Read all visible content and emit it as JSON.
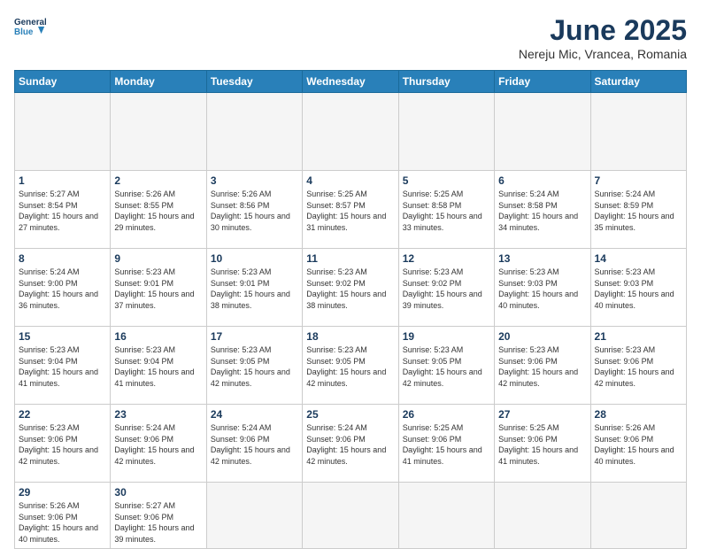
{
  "header": {
    "logo_general": "General",
    "logo_blue": "Blue",
    "title": "June 2025",
    "subtitle": "Nereju Mic, Vrancea, Romania"
  },
  "calendar": {
    "days_of_week": [
      "Sunday",
      "Monday",
      "Tuesday",
      "Wednesday",
      "Thursday",
      "Friday",
      "Saturday"
    ],
    "weeks": [
      [
        {
          "num": "",
          "empty": true
        },
        {
          "num": "",
          "empty": true
        },
        {
          "num": "",
          "empty": true
        },
        {
          "num": "",
          "empty": true
        },
        {
          "num": "",
          "empty": true
        },
        {
          "num": "",
          "empty": true
        },
        {
          "num": "",
          "empty": true
        }
      ],
      [
        {
          "num": "1",
          "sunrise": "Sunrise: 5:27 AM",
          "sunset": "Sunset: 8:54 PM",
          "daylight": "Daylight: 15 hours and 27 minutes."
        },
        {
          "num": "2",
          "sunrise": "Sunrise: 5:26 AM",
          "sunset": "Sunset: 8:55 PM",
          "daylight": "Daylight: 15 hours and 29 minutes."
        },
        {
          "num": "3",
          "sunrise": "Sunrise: 5:26 AM",
          "sunset": "Sunset: 8:56 PM",
          "daylight": "Daylight: 15 hours and 30 minutes."
        },
        {
          "num": "4",
          "sunrise": "Sunrise: 5:25 AM",
          "sunset": "Sunset: 8:57 PM",
          "daylight": "Daylight: 15 hours and 31 minutes."
        },
        {
          "num": "5",
          "sunrise": "Sunrise: 5:25 AM",
          "sunset": "Sunset: 8:58 PM",
          "daylight": "Daylight: 15 hours and 33 minutes."
        },
        {
          "num": "6",
          "sunrise": "Sunrise: 5:24 AM",
          "sunset": "Sunset: 8:58 PM",
          "daylight": "Daylight: 15 hours and 34 minutes."
        },
        {
          "num": "7",
          "sunrise": "Sunrise: 5:24 AM",
          "sunset": "Sunset: 8:59 PM",
          "daylight": "Daylight: 15 hours and 35 minutes."
        }
      ],
      [
        {
          "num": "8",
          "sunrise": "Sunrise: 5:24 AM",
          "sunset": "Sunset: 9:00 PM",
          "daylight": "Daylight: 15 hours and 36 minutes."
        },
        {
          "num": "9",
          "sunrise": "Sunrise: 5:23 AM",
          "sunset": "Sunset: 9:01 PM",
          "daylight": "Daylight: 15 hours and 37 minutes."
        },
        {
          "num": "10",
          "sunrise": "Sunrise: 5:23 AM",
          "sunset": "Sunset: 9:01 PM",
          "daylight": "Daylight: 15 hours and 38 minutes."
        },
        {
          "num": "11",
          "sunrise": "Sunrise: 5:23 AM",
          "sunset": "Sunset: 9:02 PM",
          "daylight": "Daylight: 15 hours and 38 minutes."
        },
        {
          "num": "12",
          "sunrise": "Sunrise: 5:23 AM",
          "sunset": "Sunset: 9:02 PM",
          "daylight": "Daylight: 15 hours and 39 minutes."
        },
        {
          "num": "13",
          "sunrise": "Sunrise: 5:23 AM",
          "sunset": "Sunset: 9:03 PM",
          "daylight": "Daylight: 15 hours and 40 minutes."
        },
        {
          "num": "14",
          "sunrise": "Sunrise: 5:23 AM",
          "sunset": "Sunset: 9:03 PM",
          "daylight": "Daylight: 15 hours and 40 minutes."
        }
      ],
      [
        {
          "num": "15",
          "sunrise": "Sunrise: 5:23 AM",
          "sunset": "Sunset: 9:04 PM",
          "daylight": "Daylight: 15 hours and 41 minutes."
        },
        {
          "num": "16",
          "sunrise": "Sunrise: 5:23 AM",
          "sunset": "Sunset: 9:04 PM",
          "daylight": "Daylight: 15 hours and 41 minutes."
        },
        {
          "num": "17",
          "sunrise": "Sunrise: 5:23 AM",
          "sunset": "Sunset: 9:05 PM",
          "daylight": "Daylight: 15 hours and 42 minutes."
        },
        {
          "num": "18",
          "sunrise": "Sunrise: 5:23 AM",
          "sunset": "Sunset: 9:05 PM",
          "daylight": "Daylight: 15 hours and 42 minutes."
        },
        {
          "num": "19",
          "sunrise": "Sunrise: 5:23 AM",
          "sunset": "Sunset: 9:05 PM",
          "daylight": "Daylight: 15 hours and 42 minutes."
        },
        {
          "num": "20",
          "sunrise": "Sunrise: 5:23 AM",
          "sunset": "Sunset: 9:06 PM",
          "daylight": "Daylight: 15 hours and 42 minutes."
        },
        {
          "num": "21",
          "sunrise": "Sunrise: 5:23 AM",
          "sunset": "Sunset: 9:06 PM",
          "daylight": "Daylight: 15 hours and 42 minutes."
        }
      ],
      [
        {
          "num": "22",
          "sunrise": "Sunrise: 5:23 AM",
          "sunset": "Sunset: 9:06 PM",
          "daylight": "Daylight: 15 hours and 42 minutes."
        },
        {
          "num": "23",
          "sunrise": "Sunrise: 5:24 AM",
          "sunset": "Sunset: 9:06 PM",
          "daylight": "Daylight: 15 hours and 42 minutes."
        },
        {
          "num": "24",
          "sunrise": "Sunrise: 5:24 AM",
          "sunset": "Sunset: 9:06 PM",
          "daylight": "Daylight: 15 hours and 42 minutes."
        },
        {
          "num": "25",
          "sunrise": "Sunrise: 5:24 AM",
          "sunset": "Sunset: 9:06 PM",
          "daylight": "Daylight: 15 hours and 42 minutes."
        },
        {
          "num": "26",
          "sunrise": "Sunrise: 5:25 AM",
          "sunset": "Sunset: 9:06 PM",
          "daylight": "Daylight: 15 hours and 41 minutes."
        },
        {
          "num": "27",
          "sunrise": "Sunrise: 5:25 AM",
          "sunset": "Sunset: 9:06 PM",
          "daylight": "Daylight: 15 hours and 41 minutes."
        },
        {
          "num": "28",
          "sunrise": "Sunrise: 5:26 AM",
          "sunset": "Sunset: 9:06 PM",
          "daylight": "Daylight: 15 hours and 40 minutes."
        }
      ],
      [
        {
          "num": "29",
          "sunrise": "Sunrise: 5:26 AM",
          "sunset": "Sunset: 9:06 PM",
          "daylight": "Daylight: 15 hours and 40 minutes."
        },
        {
          "num": "30",
          "sunrise": "Sunrise: 5:27 AM",
          "sunset": "Sunset: 9:06 PM",
          "daylight": "Daylight: 15 hours and 39 minutes."
        },
        {
          "num": "",
          "empty": true
        },
        {
          "num": "",
          "empty": true
        },
        {
          "num": "",
          "empty": true
        },
        {
          "num": "",
          "empty": true
        },
        {
          "num": "",
          "empty": true
        }
      ]
    ]
  }
}
